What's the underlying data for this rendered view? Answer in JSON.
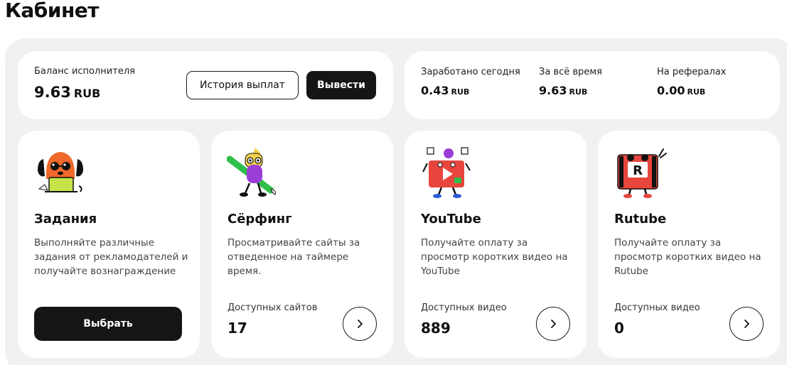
{
  "page": {
    "title": "Кабинет"
  },
  "balance": {
    "label": "Баланс исполнителя",
    "amount": "9.63",
    "currency": "RUB",
    "history_button": "История выплат",
    "withdraw_button": "Вывести"
  },
  "stats": [
    {
      "label": "Заработано сегодня",
      "amount": "0.43",
      "currency": "RUB"
    },
    {
      "label": "За всё время",
      "amount": "9.63",
      "currency": "RUB"
    },
    {
      "label": "На рефералах",
      "amount": "0.00",
      "currency": "RUB"
    }
  ],
  "features": [
    {
      "title": "Задания",
      "description": "Выполняйте различные задания от рекламодателей и получайте вознаграждение",
      "button": "Выбрать",
      "icon": "dog-mascot-laptop-icon"
    },
    {
      "title": "Сёрфинг",
      "description": "Просматривайте сайты за отведенное на таймере время.",
      "available_label": "Доступных сайтов",
      "available_count": "17",
      "icon": "surfer-mascot-icon"
    },
    {
      "title": "YouTube",
      "description": "Получайте оплату за просмотр коротких видео на YouTube",
      "available_label": "Доступных видео",
      "available_count": "889",
      "icon": "youtube-mascot-icon"
    },
    {
      "title": "Rutube",
      "description": "Получайте оплату за просмотр коротких видео на Rutube",
      "available_label": "Доступных видео",
      "available_count": "0",
      "icon": "rutube-mascot-icon"
    }
  ],
  "colors": {
    "panel_bg": "#f1f1f1",
    "card_bg": "#ffffff",
    "dark_button": "#151515",
    "youtube_red": "#e8453c",
    "accent_orange": "#f0692b",
    "accent_purple": "#9b3ed8",
    "accent_green": "#2fbf4a",
    "accent_yellow": "#f2d04a"
  }
}
